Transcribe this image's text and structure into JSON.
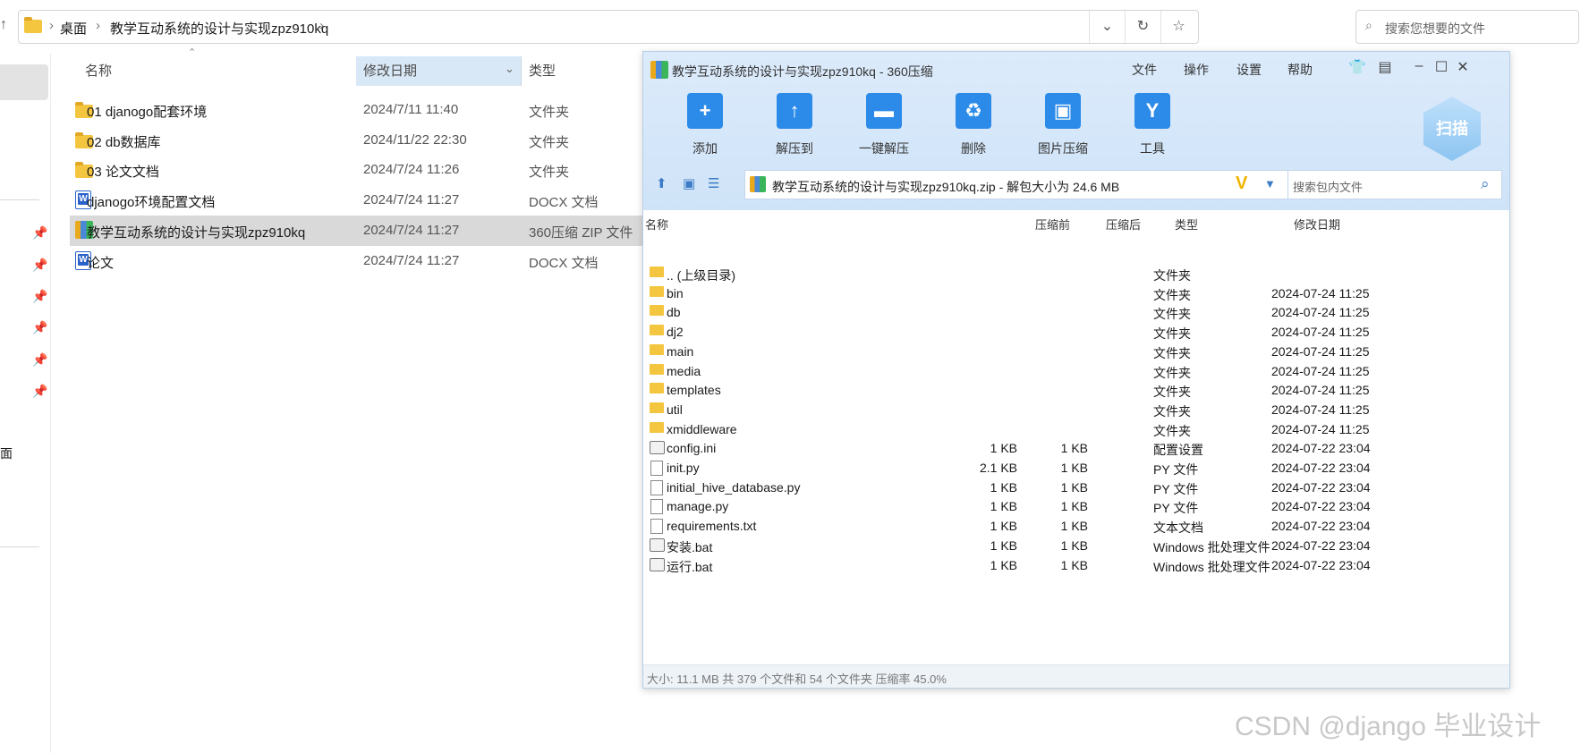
{
  "explorer": {
    "breadcrumb": [
      "桌面",
      "教学互动系统的设计与实现zpz910kq"
    ],
    "search_placeholder": "搜索您想要的文件",
    "nav_partial_label": "面",
    "columns": {
      "name": "名称",
      "date": "修改日期",
      "type": "类型"
    },
    "files": [
      {
        "icon": "folder-icon",
        "name": "01 djanogo配套环境",
        "date": "2024/7/11 11:40",
        "type": "文件夹"
      },
      {
        "icon": "folder-icon",
        "name": "02 db数据库",
        "date": "2024/11/22 22:30",
        "type": "文件夹"
      },
      {
        "icon": "folder-icon",
        "name": "03 论文文档",
        "date": "2024/7/24 11:26",
        "type": "文件夹"
      },
      {
        "icon": "word-doc-icon",
        "name": "djanogo环境配置文档",
        "date": "2024/7/24 11:27",
        "type": "DOCX 文档"
      },
      {
        "icon": "zip-archive-icon",
        "name": "教学互动系统的设计与实现zpz910kq",
        "date": "2024/7/24 11:27",
        "type": "360压缩 ZIP 文件",
        "selected": true
      },
      {
        "icon": "word-doc-icon",
        "name": "论文",
        "date": "2024/7/24 11:27",
        "type": "DOCX 文档"
      }
    ]
  },
  "zip_window": {
    "title": "教学互动系统的设计与实现zpz910kq - 360压缩",
    "menu": [
      "文件",
      "操作",
      "设置",
      "帮助"
    ],
    "toolbar": [
      {
        "label": "添加",
        "icon": "add-icon"
      },
      {
        "label": "解压到",
        "icon": "extract-icon"
      },
      {
        "label": "一键解压",
        "icon": "one-click-extract-icon"
      },
      {
        "label": "删除",
        "icon": "delete-icon"
      },
      {
        "label": "图片压缩",
        "icon": "image-compress-icon"
      },
      {
        "label": "工具",
        "icon": "tools-icon"
      }
    ],
    "scan_label": "扫描",
    "path": "教学互动系统的设计与实现zpz910kq.zip - 解包大小为 24.6 MB",
    "search_placeholder": "搜索包内文件",
    "columns": {
      "name": "名称",
      "before": "压缩前",
      "after": "压缩后",
      "type": "类型",
      "date": "修改日期"
    },
    "entries": [
      {
        "icon": "folder",
        "name": ".. (上级目录)",
        "before": "",
        "after": "",
        "type": "文件夹",
        "date": ""
      },
      {
        "icon": "folder",
        "name": "bin",
        "before": "",
        "after": "",
        "type": "文件夹",
        "date": "2024-07-24 11:25"
      },
      {
        "icon": "folder",
        "name": "db",
        "before": "",
        "after": "",
        "type": "文件夹",
        "date": "2024-07-24 11:25"
      },
      {
        "icon": "folder",
        "name": "dj2",
        "before": "",
        "after": "",
        "type": "文件夹",
        "date": "2024-07-24 11:25"
      },
      {
        "icon": "folder",
        "name": "main",
        "before": "",
        "after": "",
        "type": "文件夹",
        "date": "2024-07-24 11:25"
      },
      {
        "icon": "folder",
        "name": "media",
        "before": "",
        "after": "",
        "type": "文件夹",
        "date": "2024-07-24 11:25"
      },
      {
        "icon": "folder",
        "name": "templates",
        "before": "",
        "after": "",
        "type": "文件夹",
        "date": "2024-07-24 11:25"
      },
      {
        "icon": "folder",
        "name": "util",
        "before": "",
        "after": "",
        "type": "文件夹",
        "date": "2024-07-24 11:25"
      },
      {
        "icon": "folder",
        "name": "xmiddleware",
        "before": "",
        "after": "",
        "type": "文件夹",
        "date": "2024-07-24 11:25"
      },
      {
        "icon": "config",
        "name": "config.ini",
        "before": "1 KB",
        "after": "1 KB",
        "type": "配置设置",
        "date": "2024-07-22 23:04"
      },
      {
        "icon": "file",
        "name": "init.py",
        "before": "2.1 KB",
        "after": "1 KB",
        "type": "PY 文件",
        "date": "2024-07-22 23:04"
      },
      {
        "icon": "file",
        "name": "initial_hive_database.py",
        "before": "1 KB",
        "after": "1 KB",
        "type": "PY 文件",
        "date": "2024-07-22 23:04"
      },
      {
        "icon": "file",
        "name": "manage.py",
        "before": "1 KB",
        "after": "1 KB",
        "type": "PY 文件",
        "date": "2024-07-22 23:04"
      },
      {
        "icon": "file",
        "name": "requirements.txt",
        "before": "1 KB",
        "after": "1 KB",
        "type": "文本文档",
        "date": "2024-07-22 23:04"
      },
      {
        "icon": "batch",
        "name": "安装.bat",
        "before": "1 KB",
        "after": "1 KB",
        "type": "Windows 批处理文件",
        "date": "2024-07-22 23:04"
      },
      {
        "icon": "batch",
        "name": "运行.bat",
        "before": "1 KB",
        "after": "1 KB",
        "type": "Windows 批处理文件",
        "date": "2024-07-22 23:04"
      }
    ],
    "status": "大小: 11.1 MB 共 379 个文件和 54 个文件夹 压缩率 45.0%"
  },
  "watermark": "CSDN @django 毕业设计"
}
